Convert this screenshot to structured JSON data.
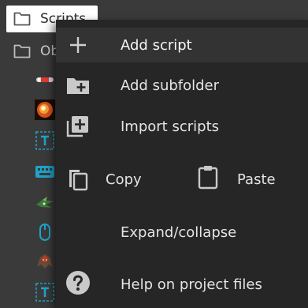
{
  "tree": {
    "scripts_folder": {
      "label": "Scripts",
      "icon": "folder-icon"
    },
    "objects_folder": {
      "label": "Ob",
      "icon": "folder-icon"
    },
    "object_icons": [
      "bullet-sprite-icon",
      "explosion-sprite-icon",
      "text-object-icon",
      "keyboard-object-icon",
      "ship-sprite-icon",
      "mouse-object-icon",
      "monster-sprite-icon",
      "text-object-icon"
    ]
  },
  "menu": {
    "add_script": {
      "label": "Add script",
      "icon": "plus-icon"
    },
    "add_subfolder": {
      "label": "Add subfolder",
      "icon": "folder-add-icon"
    },
    "import_scripts": {
      "label": "Import scripts",
      "icon": "import-icon"
    },
    "copy": {
      "label": "Copy",
      "icon": "copy-icon"
    },
    "paste": {
      "label": "Paste",
      "icon": "paste-icon"
    },
    "expand_collapse": {
      "label": "Expand/collapse"
    },
    "help": {
      "label": "Help on project files",
      "icon": "help-icon"
    }
  },
  "colors": {
    "background": "#3a3a3a",
    "menu_background": "#262626",
    "selection": "#ffffff",
    "object_accent": "#1fa3c9"
  }
}
